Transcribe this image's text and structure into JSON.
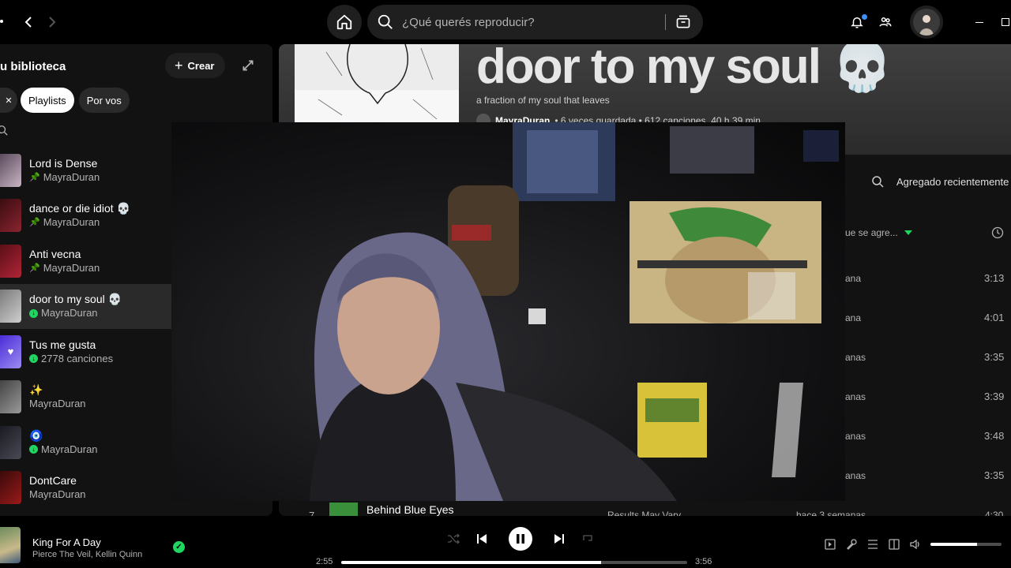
{
  "topbar": {
    "search_placeholder": "¿Qué querés reproducir?"
  },
  "library": {
    "title": "u biblioteca",
    "create_label": "Crear",
    "chips": [
      {
        "label": "Playlists",
        "active": true
      },
      {
        "label": "Por vos",
        "active": false
      }
    ],
    "items": [
      {
        "name": "Lord is Dense",
        "sub": "MayraDuran",
        "badge": "pin",
        "colors": [
          "#5a4a5c",
          "#c9b6c4"
        ]
      },
      {
        "name": "dance or die idiot 💀",
        "sub": "MayraDuran",
        "badge": "pin",
        "colors": [
          "#3a0d10",
          "#8a2430"
        ]
      },
      {
        "name": "Anti vecna",
        "sub": "MayraDuran",
        "badge": "pin",
        "colors": [
          "#5a0f18",
          "#b02436"
        ]
      },
      {
        "name": "door to my soul 💀",
        "sub": "MayraDuran",
        "badge": "dot",
        "colors": [
          "#7a7a7a",
          "#cfcfcf"
        ]
      },
      {
        "name": "Tus me gusta",
        "sub": "2778 canciones",
        "badge": "dot",
        "colors": [
          "#4b2bd8",
          "#9b8df0"
        ]
      },
      {
        "name": "✨",
        "sub": "MayraDuran",
        "badge": "none",
        "colors": [
          "#444",
          "#999"
        ]
      },
      {
        "name": "🧿",
        "sub": "MayraDuran",
        "badge": "dot",
        "colors": [
          "#1a1a22",
          "#4a4a55"
        ]
      },
      {
        "name": "DontCare",
        "sub": "MayraDuran",
        "badge": "none",
        "colors": [
          "#3a0a0a",
          "#9a1a1a"
        ]
      }
    ]
  },
  "playlist": {
    "title": "door to my soul 💀",
    "description": "a fraction of my soul that leaves",
    "owner": "MayraDuran",
    "meta": "• 6 veces guardada • 612 canciones, 40 h 39 min",
    "sort_label": "Agregado recientemente",
    "col_added": "ue se agre...",
    "rows": [
      {
        "added": "ana",
        "duration": "3:13"
      },
      {
        "added": "ana",
        "duration": "4:01"
      },
      {
        "added": "anas",
        "duration": "3:35"
      },
      {
        "added": "anas",
        "duration": "3:39"
      },
      {
        "added": "anas",
        "duration": "3:48"
      },
      {
        "added": "anas",
        "duration": "3:35"
      }
    ],
    "partial_row": {
      "num": "7",
      "name": "Behind Blue Eyes",
      "album": "Results May Vary",
      "added": "hace 3 semanas",
      "duration": "4:30"
    }
  },
  "player": {
    "title": "King For A Day",
    "artist": "Pierce The Veil, Kellin Quinn",
    "elapsed": "2:55",
    "total": "3:56",
    "progress": 0.75,
    "volume": 0.65
  },
  "colors": {
    "accent": "#1ed760",
    "surface": "#121212",
    "elevated": "#1f1f1f"
  }
}
